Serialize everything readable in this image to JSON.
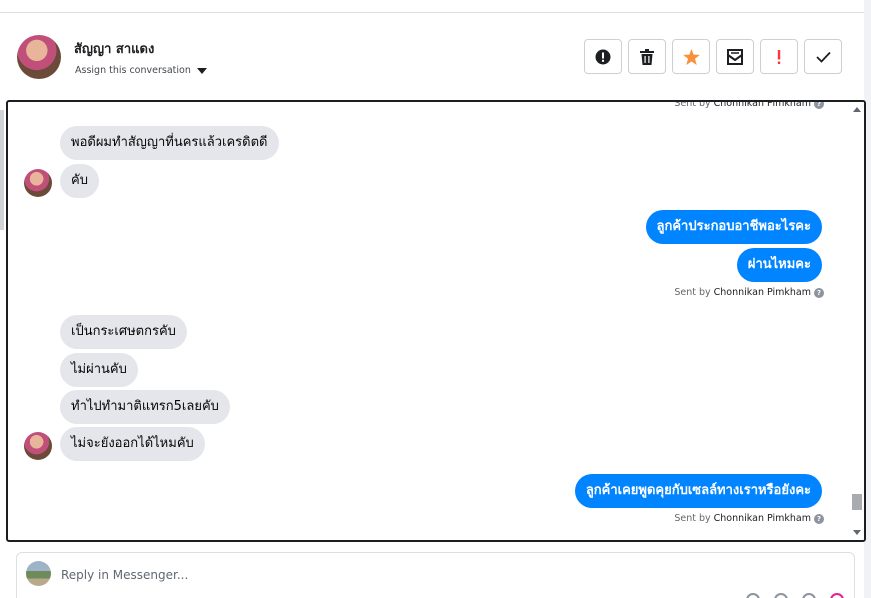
{
  "header": {
    "contact_name": "สัญญา สาแดง",
    "assign_label": "Assign this conversation",
    "actions": [
      {
        "name": "spam-icon",
        "color": "#1c1e21"
      },
      {
        "name": "trash-icon",
        "color": "#1c1e21"
      },
      {
        "name": "star-icon",
        "color": "#f7923a"
      },
      {
        "name": "archive-icon",
        "color": "#1c1e21"
      },
      {
        "name": "follow-up-icon",
        "color": "#fa383e"
      },
      {
        "name": "done-check-icon",
        "color": "#1c1e21"
      }
    ]
  },
  "thread": {
    "sent_by_prefix": "Sent by",
    "agent_name": "Chonnikan Pimkham",
    "messages": [
      {
        "dir": "in",
        "text": "พอดีผมทำสัญญาที่นครแล้วเครดิตดี"
      },
      {
        "dir": "in",
        "text": "คับ"
      },
      {
        "dir": "out",
        "text": "ลูกค้าประกอบอาชีพอะไรคะ"
      },
      {
        "dir": "out",
        "text": "ผ่านไหมคะ"
      },
      {
        "dir": "in",
        "text": "เป็นกระเศษตกรคับ"
      },
      {
        "dir": "in",
        "text": "ไม่ผ่านคับ"
      },
      {
        "dir": "in",
        "text": "ทำไปทำมาติแทรก5เลยคับ"
      },
      {
        "dir": "in",
        "text": "ไม่จะยังออกได้ไหมคับ"
      },
      {
        "dir": "out",
        "text": "ลูกค้าเคยพูดคุยกับเซลล์ทางเราหรือยังคะ"
      }
    ]
  },
  "composer": {
    "placeholder": "Reply in Messenger..."
  },
  "colors": {
    "outgoing_bubble": "#0084ff",
    "incoming_bubble": "#e4e6eb"
  }
}
